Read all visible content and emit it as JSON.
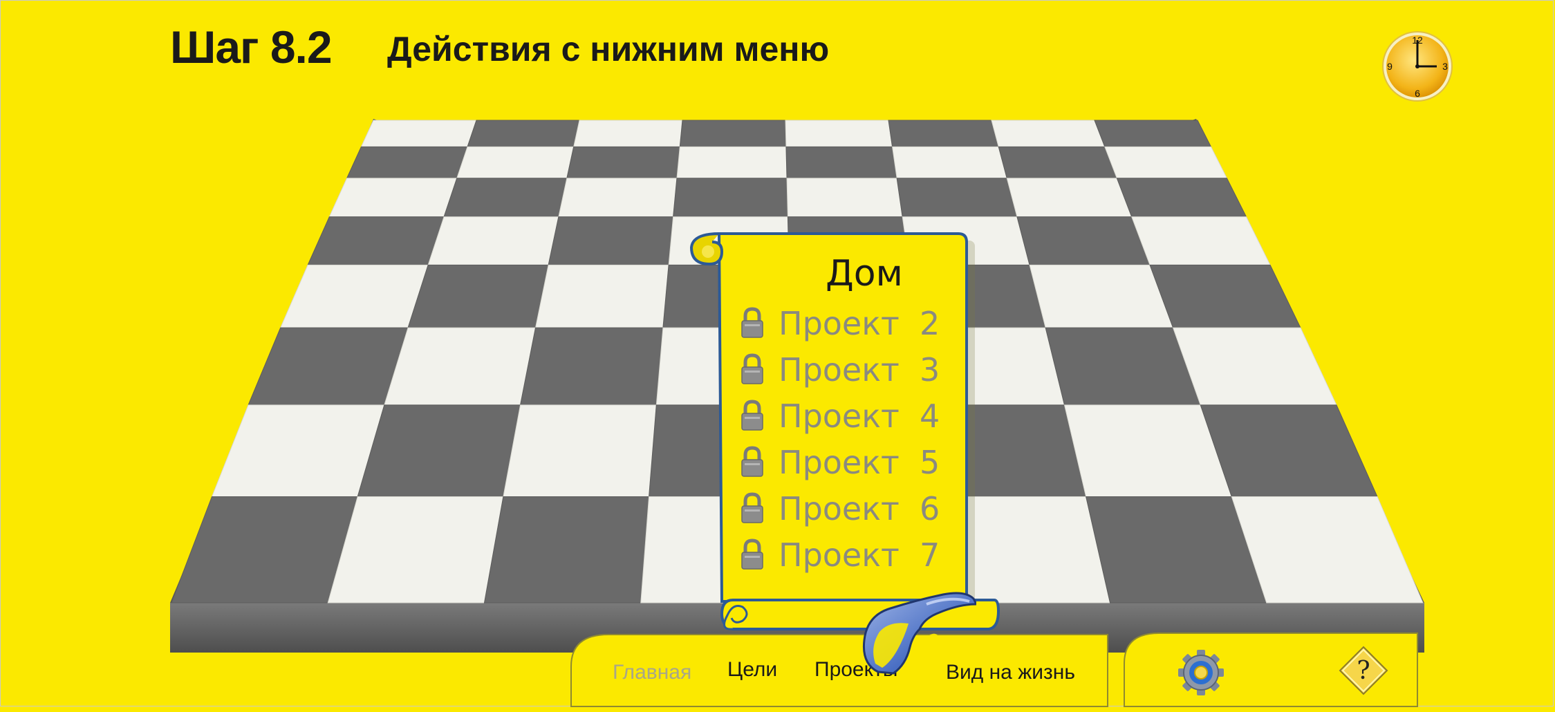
{
  "header": {
    "step_number": "Шаг 8.2",
    "step_title": "Действия с нижним меню"
  },
  "clock": {
    "icon": "clock-icon",
    "numbers": {
      "twelve": "12",
      "three": "3",
      "six": "6",
      "nine": "9"
    }
  },
  "board": {
    "description_icon": "checkerboard",
    "colors": {
      "light": "#f2f2ec",
      "dark": "#6a6a6a",
      "edge": "#5a5a5a",
      "background": "#fbe900"
    }
  },
  "dropdown": {
    "title": "Дом",
    "items": [
      {
        "label": "Проект  2",
        "locked": true
      },
      {
        "label": "Проект  3",
        "locked": true
      },
      {
        "label": "Проект  4",
        "locked": true
      },
      {
        "label": "Проект  5",
        "locked": true
      },
      {
        "label": "Проект  6",
        "locked": true
      },
      {
        "label": "Проект  7",
        "locked": true
      }
    ],
    "colors": {
      "fill": "#fbe900",
      "border": "#2c5a96",
      "item_text": "#8a8a80"
    }
  },
  "bottom_nav": {
    "items": [
      {
        "label": "Главная",
        "state": "disabled"
      },
      {
        "label": "Цели",
        "state": "normal"
      },
      {
        "label": "Проекты",
        "state": "active"
      },
      {
        "label": "Вид на жизнь",
        "state": "normal"
      }
    ],
    "settings_icon": "gear-icon",
    "help_icon": "help-icon",
    "help_glyph": "?"
  },
  "pointer": {
    "icon": "hand-pointer-icon"
  }
}
